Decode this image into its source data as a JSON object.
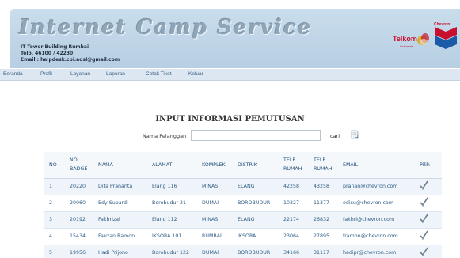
{
  "header": {
    "app_title": "Internet Camp Service",
    "line1": "IT Tower Building Rumbai",
    "line2": "Telp. 46100 / 42230",
    "line3": "Email : helpdesk.cpi.adsl@gmail.com",
    "telkom_logo": "Telkom",
    "telkom_sub": "Indonesia",
    "chevron_logo": "Chevron"
  },
  "nav": {
    "items": [
      "Beranda",
      "Profil",
      "Layanan",
      "Laporan",
      "Cetak Tiket",
      "Keluar"
    ]
  },
  "main": {
    "title": "INPUT INFORMASI PEMUTUSAN",
    "search_label": "Nama Pelanggan",
    "search_value": "",
    "search_button": "cari",
    "search_icon": "document-search-icon"
  },
  "table": {
    "headers": {
      "no": "NO",
      "no_badge_1": "NO.",
      "no_badge_2": "BADGE",
      "nama": "NAMA",
      "alamat": "ALAMAT",
      "komplek": "KOMPLEK",
      "distrik": "DISTRIK",
      "telp_rumah_1": "TELP.",
      "telp_rumah_2": "RUMAH",
      "telp_rumah2_1": "TELP.",
      "telp_rumah2_2": "RUMAH",
      "email": "EMAIL",
      "pilih": "Pilih"
    },
    "rows": [
      {
        "no": "1",
        "badge": "20220",
        "nama": "Dita Prananta",
        "alamat": "Elang 116",
        "komplek": "MINAS",
        "distrik": "ELANG",
        "telp1": "42258",
        "telp2": "43258",
        "email": "pranan@chevron.com"
      },
      {
        "no": "2",
        "badge": "20060",
        "nama": "Edy Supardi",
        "alamat": "Borobudur 21",
        "komplek": "DUMAI",
        "distrik": "BOROBUDUR",
        "telp1": "10327",
        "telp2": "11377",
        "email": "edisu@chevron.com"
      },
      {
        "no": "3",
        "badge": "20192",
        "nama": "Fakhrizal",
        "alamat": "Elang 112",
        "komplek": "MINAS",
        "distrik": "ELANG",
        "telp1": "22174",
        "telp2": "26832",
        "email": "fakhri@chevron.com"
      },
      {
        "no": "4",
        "badge": "15434",
        "nama": "Fauzan Ramon",
        "alamat": "IKSORA 101",
        "komplek": "RUMBAI",
        "distrik": "IKSORA",
        "telp1": "23064",
        "telp2": "27895",
        "email": "framon@chevron.com"
      },
      {
        "no": "5",
        "badge": "19956",
        "nama": "Hadi Prijono",
        "alamat": "Borobudur 122",
        "komplek": "DUMAI",
        "distrik": "BOROBUDUR",
        "telp1": "34166",
        "telp2": "31117",
        "email": "hadipr@chevron.com"
      }
    ]
  },
  "colors": {
    "banner_bg": "#c9ddec",
    "nav_bg": "#dce7f1",
    "link_text": "#2f5d86",
    "title_text": "#333333"
  }
}
